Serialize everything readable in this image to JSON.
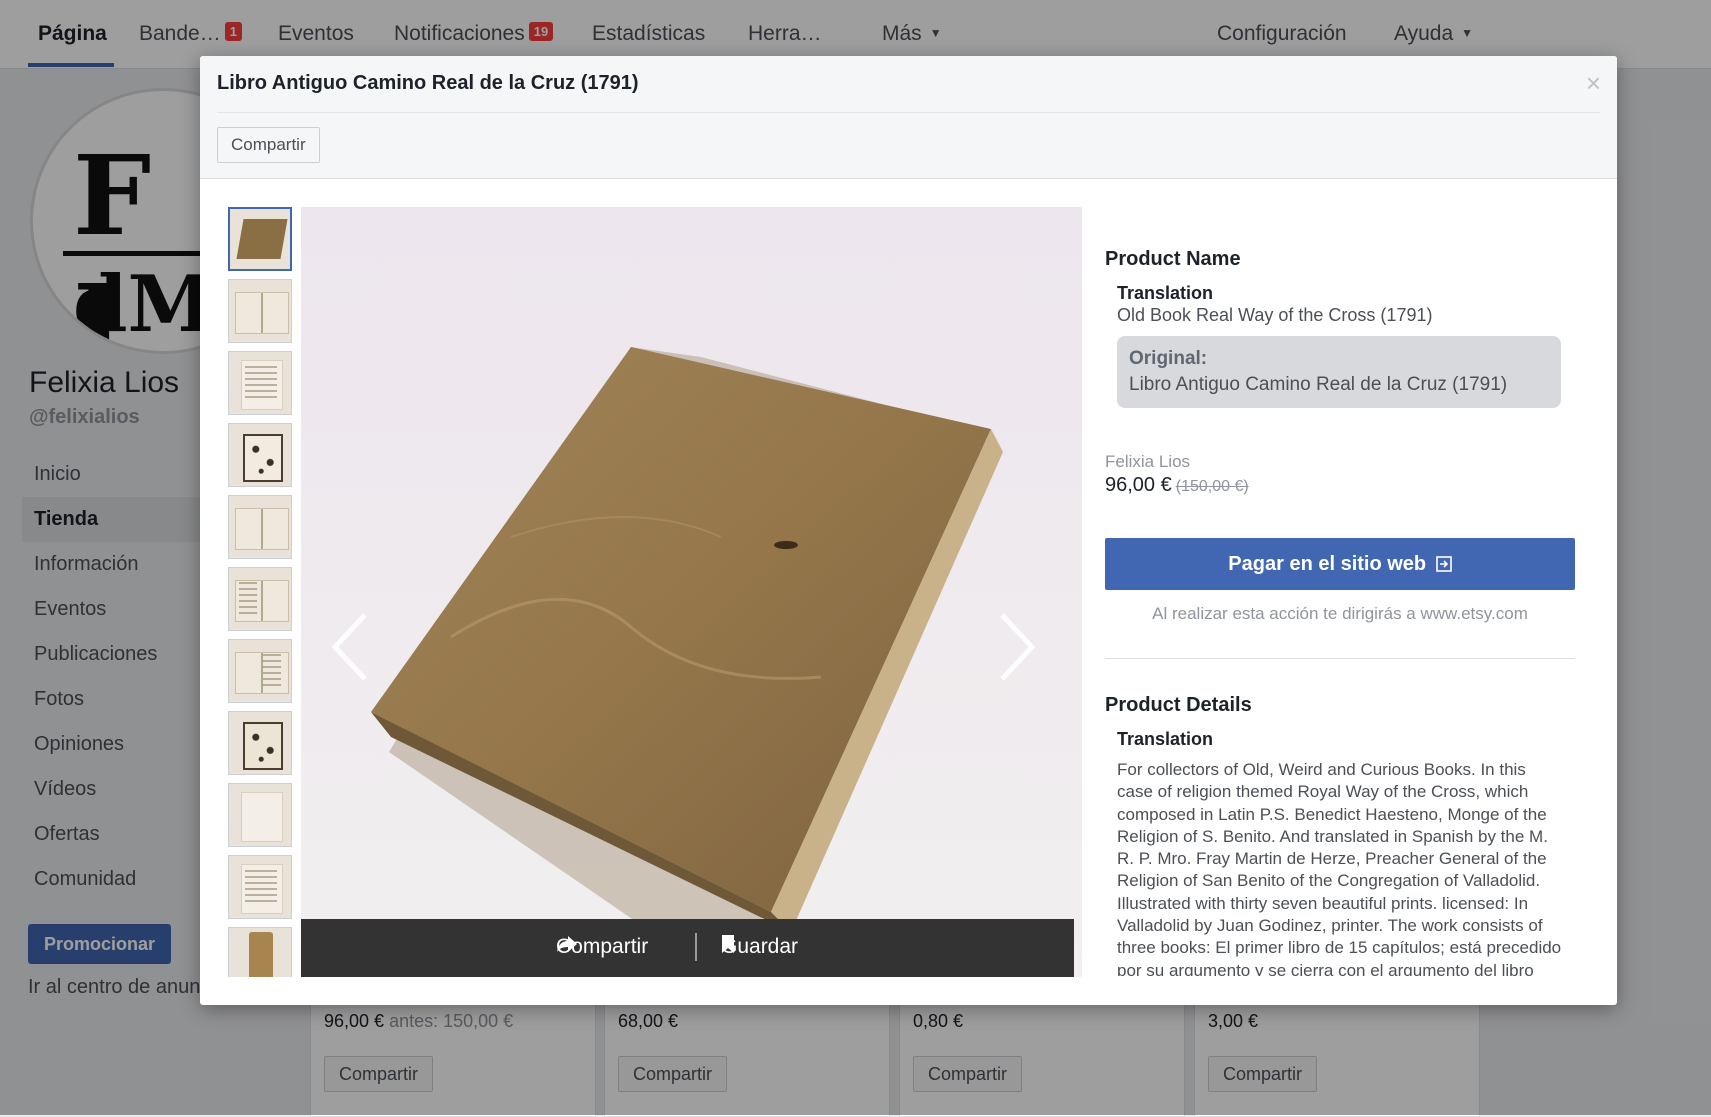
{
  "topnav": {
    "items": [
      {
        "label": "Página"
      },
      {
        "label": "Bande…",
        "badge": "1"
      },
      {
        "label": "Eventos"
      },
      {
        "label": "Notificaciones",
        "badge": "19"
      },
      {
        "label": "Estadísticas"
      },
      {
        "label": "Herra…"
      },
      {
        "label": "Más"
      },
      {
        "label": "Configuración"
      },
      {
        "label": "Ayuda"
      }
    ],
    "dropdown_caret": "▼"
  },
  "page": {
    "name": "Felixia Lios",
    "handle": "@felixialios",
    "menu": [
      "Inicio",
      "Tienda",
      "Información",
      "Eventos",
      "Publicaciones",
      "Fotos",
      "Opiniones",
      "Vídeos",
      "Ofertas",
      "Comunidad"
    ],
    "active_menu": "Tienda",
    "promote_label": "Promocionar",
    "ads_center_label": "Ir al centro de anun",
    "logo_text_top": "F I",
    "logo_text_bottom": "dMO"
  },
  "shop": {
    "cards": [
      {
        "price": "96,00 €",
        "old_price": "antes: 150,00 €",
        "share_label": "Compartir"
      },
      {
        "price": "68,00 €",
        "old_price": "",
        "share_label": "Compartir"
      },
      {
        "price": "0,80 €",
        "old_price": "",
        "share_label": "Compartir"
      },
      {
        "price": "3,00 €",
        "old_price": "",
        "share_label": "Compartir"
      }
    ]
  },
  "modal": {
    "title": "Libro Antiguo Camino Real de la Cruz (1791)",
    "close_glyph": "×",
    "share_label": "Compartir",
    "thumbnails": [
      "cover",
      "open-book",
      "title-page",
      "print",
      "spread",
      "spread",
      "spread",
      "print",
      "page",
      "page",
      "spine"
    ],
    "selected_thumbnail": 0,
    "viewer": {
      "share_label": "Compartir",
      "save_label": "Guardar",
      "share_icon": "share-arrow-icon",
      "save_icon": "bookmark-icon"
    },
    "product": {
      "name_title": "Product Name",
      "translation_label": "Translation",
      "translation": "Old Book Real Way of the Cross (1791)",
      "original_label": "Original:",
      "original": "Libro Antiguo Camino Real de la Cruz (1791)",
      "seller": "Felixia Lios",
      "price": "96,00 €",
      "old_price": "(150,00 €)",
      "pay_label": "Pagar en el sitio web",
      "pay_icon": "external-link-icon",
      "redirect_note": "Al realizar esta acción te dirigirás a www.etsy.com",
      "details_title": "Product Details",
      "details_translation_label": "Translation",
      "details_text": "For collectors of Old, Weird and Curious Books. In this case of religion themed Royal Way of the Cross, which composed in Latin P.S. Benedict Haesteno, Monge of the Religion of S. Benito. And translated in Spanish by the M. R. P. Mro. Fray Martin de Herze, Preacher General of the Religion of San Benito of the Congregation of Valladolid. Illustrated with thirty seven beautiful prints. licensed: In Valladolid by Juan Godinez, printer. The work consists of three books: El primer libro de 15 capítulos; está precedido por su argumento y se cierra con el argumento del libro siguiente. El segundo libro \"del modo mejor de llevar la cruz\" consta de 2 capítulos, y termina con el"
    }
  },
  "colors": {
    "brand_blue": "#4267b2",
    "badge_red": "#fa3e3e",
    "viewer_bar": "#333333"
  }
}
